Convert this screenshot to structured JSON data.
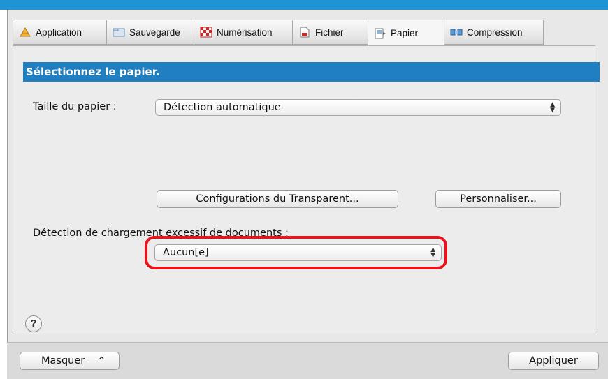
{
  "tabs": [
    {
      "label": "Application",
      "icon": "application-icon"
    },
    {
      "label": "Sauvegarde",
      "icon": "folder-icon"
    },
    {
      "label": "Numérisation",
      "icon": "scan-icon"
    },
    {
      "label": "Fichier",
      "icon": "file-icon"
    },
    {
      "label": "Papier",
      "icon": "paper-icon"
    },
    {
      "label": "Compression",
      "icon": "compression-icon"
    }
  ],
  "selected_tab": "Papier",
  "section_title": "Sélectionnez le papier.",
  "paper_size": {
    "label": "Taille du papier :",
    "value": "Détection automatique"
  },
  "buttons": {
    "transparent": "Configurations du Transparent...",
    "customize": "Personnaliser..."
  },
  "overload": {
    "label": "Détection de chargement excessif de documents :",
    "value": "Aucun[e]"
  },
  "help_label": "?",
  "footer": {
    "hide": "Masquer",
    "hide_arrow": "^",
    "apply": "Appliquer"
  },
  "colors": {
    "accent": "#1f7fc0",
    "highlight": "#e8141b"
  }
}
